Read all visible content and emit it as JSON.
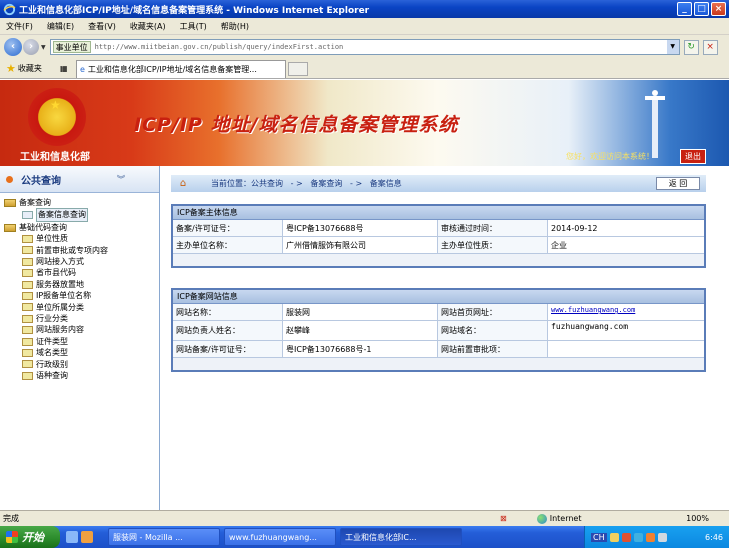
{
  "window": {
    "title": "工业和信息化部ICP/IP地址/域名信息备案管理系统 - Windows Internet Explorer",
    "min": "_",
    "max": "□",
    "close": "×"
  },
  "menu": [
    "文件(F)",
    "编辑(E)",
    "查看(V)",
    "收藏夹(A)",
    "工具(T)",
    "帮助(H)"
  ],
  "address": {
    "zone": "事业单位",
    "url": "http://www.miitbeian.gov.cn/publish/query/indexFirst.action"
  },
  "favorites": {
    "label": "收藏夹"
  },
  "tab": {
    "label": "工业和信息化部ICP/IP地址/域名信息备案管理..."
  },
  "banner": {
    "ministry": "工业和信息化部",
    "system_title": "ICP/IP 地址/域名信息备案管理系统",
    "welcome": "您好，欢迎访问本系统！",
    "logout": "退出"
  },
  "sidebar": {
    "header": "公共查询",
    "groups": [
      {
        "label": "备案查询",
        "items": [
          "备案信息查询"
        ]
      },
      {
        "label": "基础代码查询",
        "items": [
          "单位性质",
          "前置审批或专项内容",
          "网站接入方式",
          "省市县代码",
          "服务器放置地",
          "IP报备单位名称",
          "单位所属分类",
          "行业分类",
          "网站服务内容",
          "证件类型",
          "域名类型",
          "行政级别",
          "语种查询"
        ]
      }
    ]
  },
  "breadcrumb": {
    "text": "当前位置：公共查询   - >   备案查询   - >   备案信息",
    "back": "返  回"
  },
  "subject_panel": {
    "title": "ICP备案主体信息",
    "license_label": "备案/许可证号：",
    "license": "粤ICP备13076688号",
    "approve_label": "审核通过时间：",
    "approve_date": "2014-09-12",
    "org_label": "主办单位名称：",
    "org": "广州借情服饰有限公司",
    "nature_label": "主办单位性质：",
    "nature": "企业"
  },
  "site_panel": {
    "title": "ICP备案网站信息",
    "name_label": "网站名称：",
    "name": "服装网",
    "home_label": "网站首页网址：",
    "home": "www.fuzhuangwang.com",
    "owner_label": "网站负责人姓名：",
    "owner": "赵攀峰",
    "domain_label": "网站域名：",
    "domain": "fuzhuangwang.com",
    "license_label": "网站备案/许可证号：",
    "license": "粤ICP备13076688号-1",
    "pre_label": "网站前置审批项：",
    "pre": ""
  },
  "status": {
    "left": "完成",
    "zone": "Internet",
    "zoom": "100%"
  },
  "taskbar": {
    "start": "开始",
    "tasks": [
      "服装网 - Mozilla ...",
      "www.fuzhuangwang...",
      "工业和信息化部IC..."
    ],
    "ime": "CH",
    "clock": "6:46"
  }
}
